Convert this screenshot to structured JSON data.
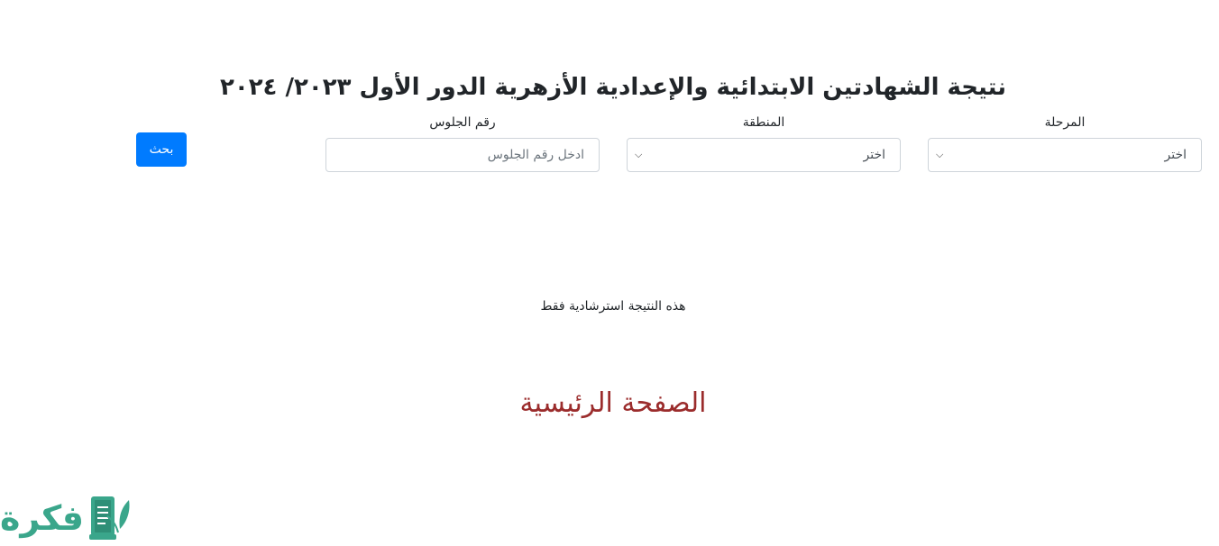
{
  "page": {
    "title": "نتيجة الشهادتين الابتدائية والإعدادية الأزهرية الدور الأول ٢٠٢٣/ ٢٠٢٤"
  },
  "form": {
    "stage": {
      "label": "المرحلة",
      "value": "اختر"
    },
    "region": {
      "label": "المنطقة",
      "value": "اختر"
    },
    "seat": {
      "label": "رقم الجلوس",
      "placeholder": "ادخل رقم الجلوس"
    },
    "search_label": "بحث"
  },
  "note": "هذه النتيجة استرشادية فقط",
  "home_link": "الصفحة الرئيسية",
  "brand": {
    "name": "فكرة",
    "icon": "notebook-leaf-icon"
  },
  "colors": {
    "primary": "#007bff",
    "home_link": "#9b2c2c",
    "brand": "#3aa68b"
  }
}
